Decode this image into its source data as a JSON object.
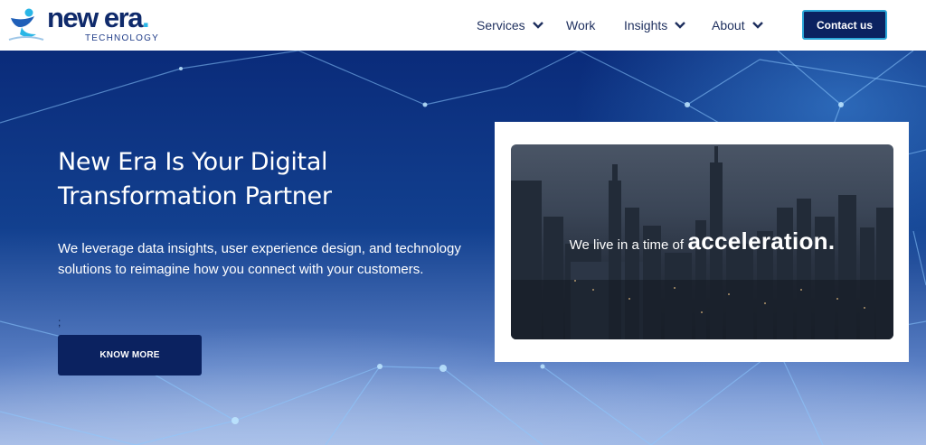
{
  "brand": {
    "name": "new era",
    "dot": ".",
    "tagline": "TECHNOLOGY",
    "colors": {
      "primary": "#0b2260",
      "accent": "#29b6e6"
    }
  },
  "nav": {
    "items": [
      {
        "label": "Services",
        "has_dropdown": true,
        "icon": "chevron-down-icon"
      },
      {
        "label": "Work",
        "has_dropdown": false
      },
      {
        "label": "Insights",
        "has_dropdown": true,
        "icon": "chevron-down-icon"
      },
      {
        "label": "About",
        "has_dropdown": true,
        "icon": "chevron-down-icon"
      }
    ],
    "contact_label": "Contact us"
  },
  "hero": {
    "title": "New Era Is Your Digital Transformation Partner",
    "description": "We leverage data insights, user experience design, and technology solutions to reimagine how you connect with your customers.",
    "stray_text": ";",
    "cta_label": "KNOW MORE"
  },
  "video": {
    "text_small": "We live in a time of",
    "text_big": "acceleration."
  }
}
